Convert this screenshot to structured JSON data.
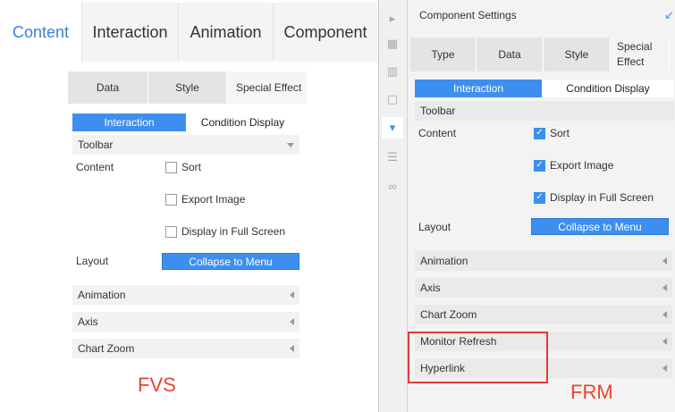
{
  "left": {
    "tabs": [
      "Content",
      "Interaction",
      "Animation",
      "Component"
    ],
    "subtabs": [
      "Data",
      "Style",
      "Special Effect"
    ],
    "segment": [
      "Interaction",
      "Condition Display"
    ],
    "toolbar_label": "Toolbar",
    "content_label": "Content",
    "checks": [
      {
        "label": "Sort",
        "checked": false
      },
      {
        "label": "Export Image",
        "checked": false
      },
      {
        "label": "Display in Full Screen",
        "checked": false
      }
    ],
    "layout_label": "Layout",
    "layout_value": "Collapse to Menu",
    "sections": [
      "Animation",
      "Axis",
      "Chart Zoom"
    ],
    "tag": "FVS"
  },
  "right": {
    "header": "Component Settings",
    "subtabs": [
      "Type",
      "Data",
      "Style",
      "Special Effect"
    ],
    "segment": [
      "Interaction",
      "Condition Display"
    ],
    "toolbar_label": "Toolbar",
    "content_label": "Content",
    "checks": [
      {
        "label": "Sort",
        "checked": true
      },
      {
        "label": "Export Image",
        "checked": true
      },
      {
        "label": "Display in Full Screen",
        "checked": true
      }
    ],
    "layout_label": "Layout",
    "layout_value": "Collapse to Menu",
    "sections": [
      "Animation",
      "Axis",
      "Chart Zoom",
      "Monitor Refresh",
      "Hyperlink"
    ],
    "tag": "FRM"
  },
  "colors": {
    "accent": "#3d8fef",
    "highlight": "#e53935",
    "tag": "#e8462e"
  },
  "icons": {
    "strip": [
      "collapse-arrow-icon",
      "table-icon",
      "chart-icon",
      "frame-icon",
      "dropdown-icon",
      "form-list-icon",
      "link-icon"
    ]
  }
}
